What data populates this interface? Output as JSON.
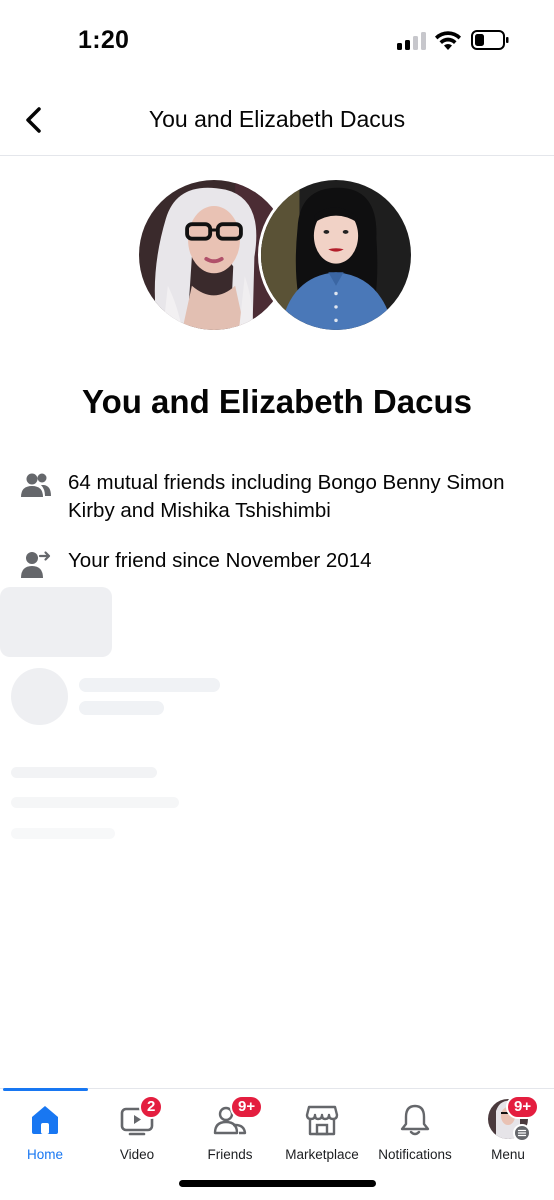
{
  "status_bar": {
    "time": "1:20",
    "signal_bars_active": 2,
    "battery_level": 0.25
  },
  "header": {
    "back_icon": "chevron-left-icon",
    "title": "You and Elizabeth Dacus"
  },
  "profile": {
    "main_title": "You and Elizabeth Dacus",
    "avatars": [
      "user-avatar",
      "friend-avatar"
    ]
  },
  "info": {
    "mutual_icon": "people-icon",
    "mutual_text": "64 mutual friends including Bongo Benny Simon Kirby and Mishika Tshishimbi",
    "since_icon": "friend-arrow-icon",
    "since_text": "Your friend since November 2014"
  },
  "tabs": [
    {
      "label": "Home",
      "icon": "home-icon",
      "active": true,
      "badge": ""
    },
    {
      "label": "Video",
      "icon": "video-icon",
      "active": false,
      "badge": "2"
    },
    {
      "label": "Friends",
      "icon": "friends-icon",
      "active": false,
      "badge": "9+"
    },
    {
      "label": "Marketplace",
      "icon": "marketplace-icon",
      "active": false,
      "badge": ""
    },
    {
      "label": "Notifications",
      "icon": "bell-icon",
      "active": false,
      "badge": ""
    },
    {
      "label": "Menu",
      "icon": "menu-avatar-icon",
      "active": false,
      "badge": "9+"
    }
  ],
  "colors": {
    "accent": "#1877f2",
    "badge": "#e41e3f",
    "icon_gray": "#65676b",
    "skeleton": "#f0f2f5"
  }
}
